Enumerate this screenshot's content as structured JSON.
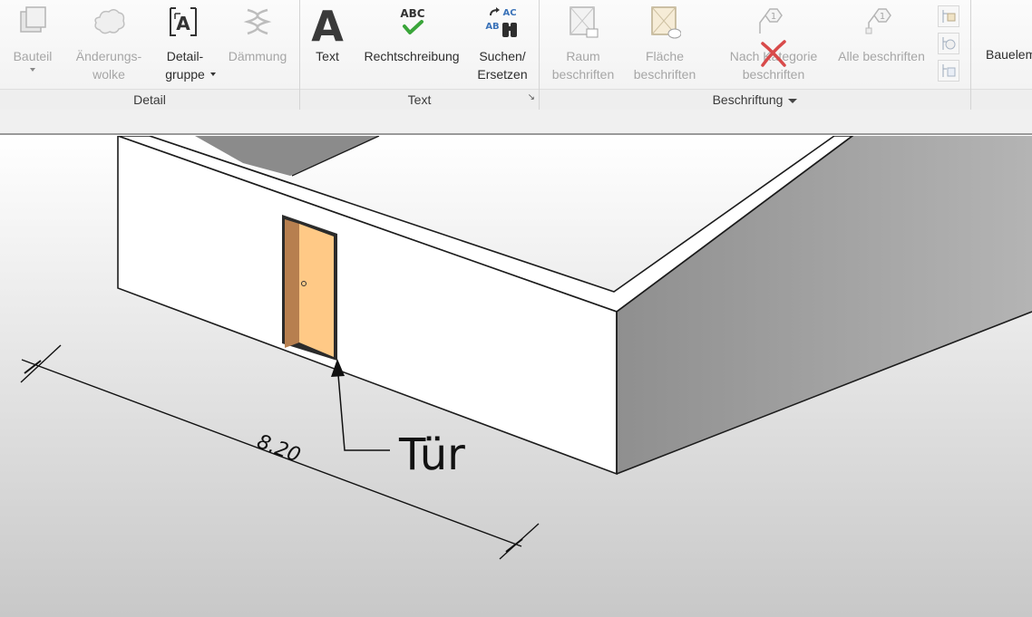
{
  "ribbon": {
    "groups": [
      {
        "label": "Detail"
      },
      {
        "label": "Text"
      },
      {
        "label": "Beschriftung"
      }
    ],
    "tools": {
      "bauteil": {
        "label": "Bauteil"
      },
      "aenderungswolke": {
        "line1": "Änderungs-",
        "line2": "wolke"
      },
      "detailgruppe": {
        "line1": "Detail-",
        "line2": "gruppe"
      },
      "daemmung": {
        "label": "Dämmung"
      },
      "text": {
        "label": "Text"
      },
      "rechtschreibung": {
        "label": "Rechtschreibung",
        "icon_text": "ABC"
      },
      "suchen": {
        "line1": "Suchen/",
        "line2": "Ersetzen",
        "icon_text1": "AC",
        "icon_text2": "AB"
      },
      "raum": {
        "line1": "Raum",
        "line2": "beschriften"
      },
      "flaeche": {
        "line1": "Fläche",
        "line2": "beschriften"
      },
      "nach_kategorie": {
        "line1": "Nach Kategorie",
        "line2": "beschriften"
      },
      "alle": {
        "label": "Alle beschriften"
      },
      "bauelemente": {
        "label": "Bauelem"
      }
    },
    "tag_icon_number": "1"
  },
  "drawing": {
    "dimension_value": "8.20",
    "door_tag": "Tür"
  },
  "colors": {
    "ribbon_bg": "#f3f3f3",
    "door_leaf": "#ffc986",
    "door_jamb": "#b77f4f",
    "wall_face": "#ffffff",
    "disabled_x": "#d84a4a",
    "check_green": "#3aa53a"
  }
}
